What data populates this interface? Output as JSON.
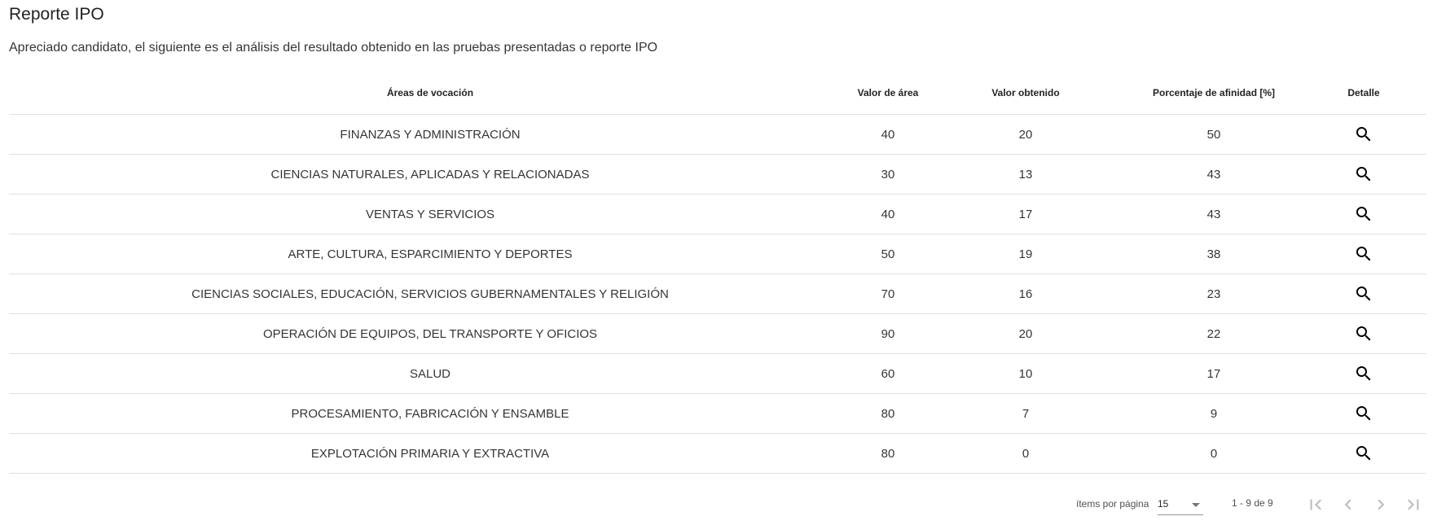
{
  "page": {
    "title": "Reporte IPO",
    "intro": "Apreciado candidato, el siguiente es el análisis del resultado obtenido en las pruebas presentadas o reporte IPO"
  },
  "table": {
    "headers": {
      "area": "Áreas de vocación",
      "valor_area": "Valor de área",
      "valor_obtenido": "Valor obtenido",
      "porcentaje": "Porcentaje de afinidad [%]",
      "detalle": "Detalle"
    },
    "rows": [
      {
        "area": "FINANZAS Y ADMINISTRACIÓN",
        "valor_area": "40",
        "valor_obtenido": "20",
        "porcentaje": "50",
        "detail_icon": "search-icon"
      },
      {
        "area": "CIENCIAS NATURALES, APLICADAS Y RELACIONADAS",
        "valor_area": "30",
        "valor_obtenido": "13",
        "porcentaje": "43",
        "detail_icon": "search-icon"
      },
      {
        "area": "VENTAS Y SERVICIOS",
        "valor_area": "40",
        "valor_obtenido": "17",
        "porcentaje": "43",
        "detail_icon": "search-icon"
      },
      {
        "area": "ARTE, CULTURA, ESPARCIMIENTO Y DEPORTES",
        "valor_area": "50",
        "valor_obtenido": "19",
        "porcentaje": "38",
        "detail_icon": "search-icon"
      },
      {
        "area": "CIENCIAS SOCIALES, EDUCACIÓN, SERVICIOS GUBERNAMENTALES Y RELIGIÓN",
        "valor_area": "70",
        "valor_obtenido": "16",
        "porcentaje": "23",
        "detail_icon": "search-icon"
      },
      {
        "area": "OPERACIÓN DE EQUIPOS, DEL TRANSPORTE Y OFICIOS",
        "valor_area": "90",
        "valor_obtenido": "20",
        "porcentaje": "22",
        "detail_icon": "search-icon"
      },
      {
        "area": "SALUD",
        "valor_area": "60",
        "valor_obtenido": "10",
        "porcentaje": "17",
        "detail_icon": "search-icon"
      },
      {
        "area": "PROCESAMIENTO, FABRICACIÓN Y ENSAMBLE",
        "valor_area": "80",
        "valor_obtenido": "7",
        "porcentaje": "9",
        "detail_icon": "search-icon"
      },
      {
        "area": "EXPLOTACIÓN PRIMARIA Y EXTRACTIVA",
        "valor_area": "80",
        "valor_obtenido": "0",
        "porcentaje": "0",
        "detail_icon": "search-icon"
      }
    ]
  },
  "paginator": {
    "items_label": "ítems por página",
    "page_size": "15",
    "range_label": "1 - 9 de 9",
    "icons": [
      "first-page-icon",
      "previous-page-icon",
      "next-page-icon",
      "last-page-icon"
    ]
  },
  "colors": {
    "text_primary": "#212121",
    "divider": "#e0e0e0",
    "icon": "#000000",
    "disabled_icon": "#bdbdbd"
  }
}
